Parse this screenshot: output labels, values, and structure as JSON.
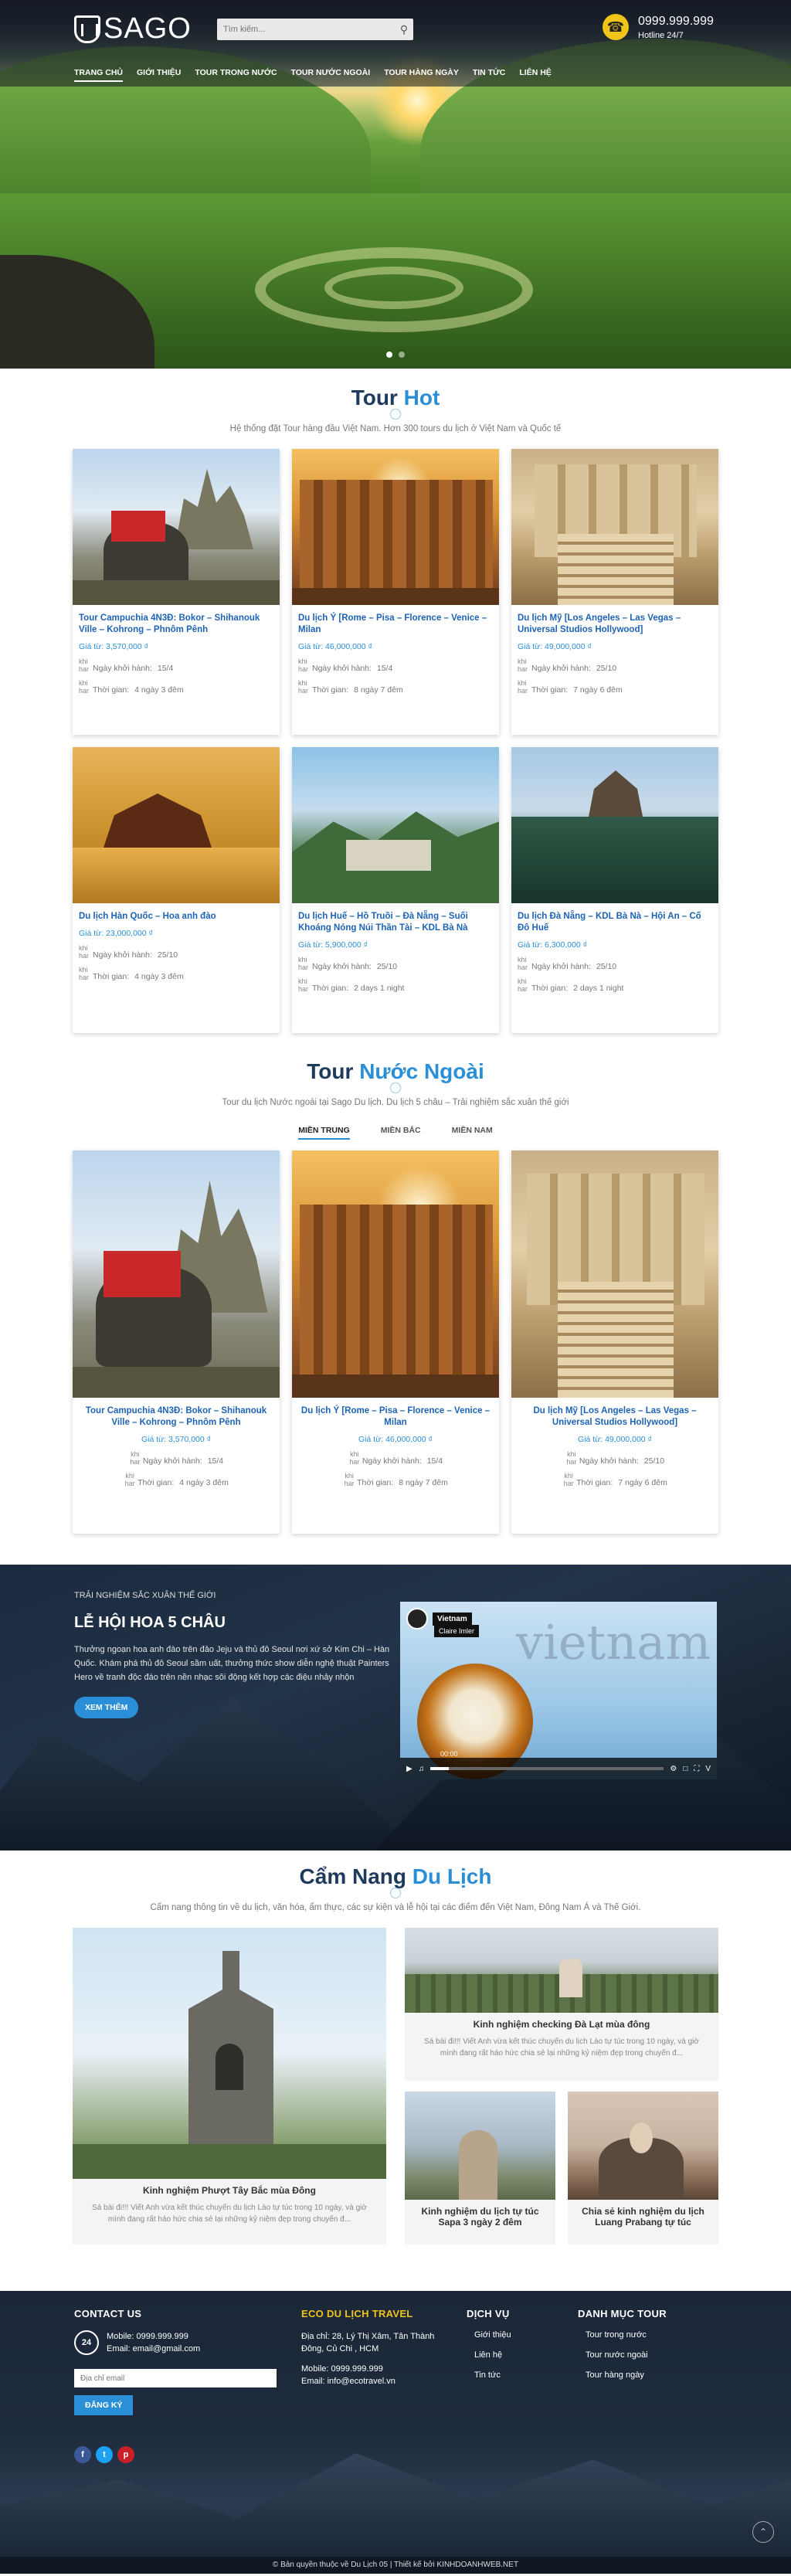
{
  "header": {
    "logo_text": "SAGO",
    "search_placeholder": "Tìm kiếm...",
    "hotline_number": "0999.999.999",
    "hotline_sub": "Hotline 24/7",
    "nav": [
      "TRANG CHỦ",
      "GIỚI THIỆU",
      "TOUR TRONG NƯỚC",
      "TOUR NƯỚC NGOÀI",
      "TOUR HÀNG NGÀY",
      "TIN TỨC",
      "LIÊN HỆ"
    ]
  },
  "hot": {
    "title_a": "Tour",
    "title_b": "Hot",
    "desc": "Hệ thống đặt Tour hàng đầu Việt Nam. Hơn 300 tours du lịch ở Việt Nam và Quốc tế",
    "meta_label_date": "Ngày khởi hành:",
    "meta_label_time": "Thời gian:",
    "icon_alt": "khi har",
    "cards": [
      {
        "title": "Tour Campuchia 4N3Đ: Bokor – Shihanouk Ville – Kohrong – Phnôm Pênh",
        "price": "Giá từ: 3,570,000 ₫",
        "date": "15/4",
        "time": "4 ngày 3 đêm"
      },
      {
        "title": "Du lịch Ý [Rome – Pisa – Florence – Venice – Milan",
        "price": "Giá từ: 46,000,000 ₫",
        "date": "15/4",
        "time": "8 ngày 7 đêm"
      },
      {
        "title": "Du lịch Mỹ [Los Angeles – Las Vegas – Universal Studios Hollywood]",
        "price": "Giá từ: 49,000,000 ₫",
        "date": "25/10",
        "time": "7 ngày 6 đêm"
      },
      {
        "title": "Du lịch Hàn Quốc – Hoa anh đào",
        "price": "Giá từ: 23,000,000 ₫",
        "date": "25/10",
        "time": "4 ngày 3 đêm"
      },
      {
        "title": "Du lịch Huế – Hồ Truồi – Đà Nẵng – Suối Khoáng Nóng Núi Thần Tài – KDL Bà Nà",
        "price": "Giá từ: 5,900,000 ₫",
        "date": "25/10",
        "time": "2 days 1 night"
      },
      {
        "title": "Du lịch Đà Nẵng – KDL Bà Nà – Hội An – Cố Đô Huế",
        "price": "Giá từ: 6,300,000 ₫",
        "date": "25/10",
        "time": "2 days 1 night"
      }
    ]
  },
  "foreign": {
    "title_a": "Tour",
    "title_b": "Nước Ngoài",
    "desc": "Tour du lịch Nước ngoài tại Sago Du lịch. Du lịch 5 châu – Trải nghiệm sắc xuân thế giới",
    "tabs": [
      "MIỀN TRUNG",
      "MIỀN BẮC",
      "MIỀN NAM"
    ],
    "cards": [
      {
        "title": "Tour Campuchia 4N3Đ: Bokor – Shihanouk Ville – Kohrong – Phnôm Pênh",
        "price": "Giá từ: 3,570,000 ₫",
        "date": "15/4",
        "time": "4 ngày 3 đêm"
      },
      {
        "title": "Du lịch Ý [Rome – Pisa – Florence – Venice – Milan",
        "price": "Giá từ: 46,000,000 ₫",
        "date": "15/4",
        "time": "8 ngày 7 đêm"
      },
      {
        "title": "Du lịch Mỹ [Los Angeles – Las Vegas – Universal Studios Hollywood]",
        "price": "Giá từ: 49,000,000 ₫",
        "date": "25/10",
        "time": "7 ngày 6 đêm"
      }
    ]
  },
  "festival": {
    "kicker": "TRẢI NGHIỆM SẮC XUÂN THẾ GIỚI",
    "title": "LỄ HỘI HOA 5 CHÂU",
    "text": "Thưởng ngoạn hoa anh đào trên đảo Jeju và thủ đô Seoul nơi xứ sở Kim Chi – Hàn Quốc. Khám phá thủ đô Seoul sầm uất, thưởng thức show diễn nghệ thuật Painters Hero về tranh độc đáo trên nền nhạc sôi động kết hợp các điệu nhảy nhộn",
    "button": "XEM THÊM",
    "video": {
      "channel": "Vietnam",
      "title": "Claire Imler",
      "watermark": "vietnam",
      "time": "00:00"
    }
  },
  "handbook": {
    "title_a": "Cẩm Nang",
    "title_b": "Du Lịch",
    "desc": "Cẩm nang thông tin về du lịch, văn hóa, ẩm thực, các sự kiện và lễ hội tại các điểm đến Việt Nam, Đông Nam Á và Thế Giới.",
    "big": {
      "title": "Kinh nghiệm Phượt Tây Bắc mùa Đông",
      "desc": "Sá bài đi!!! Viết Anh vừa kết thúc chuyến du lịch Lào tự túc trong 10 ngày, và giờ mình đang rất háo hức chia sẻ lại những kỷ niệm đẹp trong chuyến đ..."
    },
    "top": {
      "title": "Kinh nghiệm checking Đà Lạt mùa đông",
      "desc": "Sá bài đi!!! Viết Anh vừa kết thúc chuyến du lịch Lào tự túc trong 10 ngày, và giờ mình đang rất háo hức chia sẻ lại những kỷ niệm đẹp trong chuyến đ..."
    },
    "small1": {
      "title": "Kinh nghiệm du lịch tự túc Sapa 3 ngày 2 đêm"
    },
    "small2": {
      "title": "Chia sẻ kinh nghiệm du lịch Luang Prabang tự túc"
    }
  },
  "footer": {
    "contact_title": "CONTACT US",
    "badge": "24",
    "mobile": "Mobile: 0999.999.999",
    "email": "Email: email@gmail.com",
    "email_placeholder": "Địa chỉ email",
    "subscribe": "ĐĂNG KÝ",
    "eco_title": "ECO DU LỊCH TRAVEL",
    "eco_address": "Địa chỉ: 28, Lý Thị Xâm, Tân Thành Đông, Củ Chi , HCM",
    "eco_mobile": "Mobile: 0999.999.999",
    "eco_email": "Email: info@ecotravel.vn",
    "dv_title": "DỊCH VỤ",
    "dv_items": [
      "Giới thiệu",
      "Liên hệ",
      "Tin tức"
    ],
    "dm_title": "DANH MỤC TOUR",
    "dm_items": [
      "Tour trong nước",
      "Tour nước ngoài",
      "Tour hàng ngày"
    ],
    "copyright": "© Bản quyền thuộc về Du Lịch 05 | Thiết kế bởi KINHDOANHWEB.NET",
    "socials": [
      "f",
      "t",
      "p"
    ]
  },
  "colors": {
    "accent": "#2a8fd6",
    "navy": "#1e3a5c",
    "gold": "#f0c419"
  }
}
